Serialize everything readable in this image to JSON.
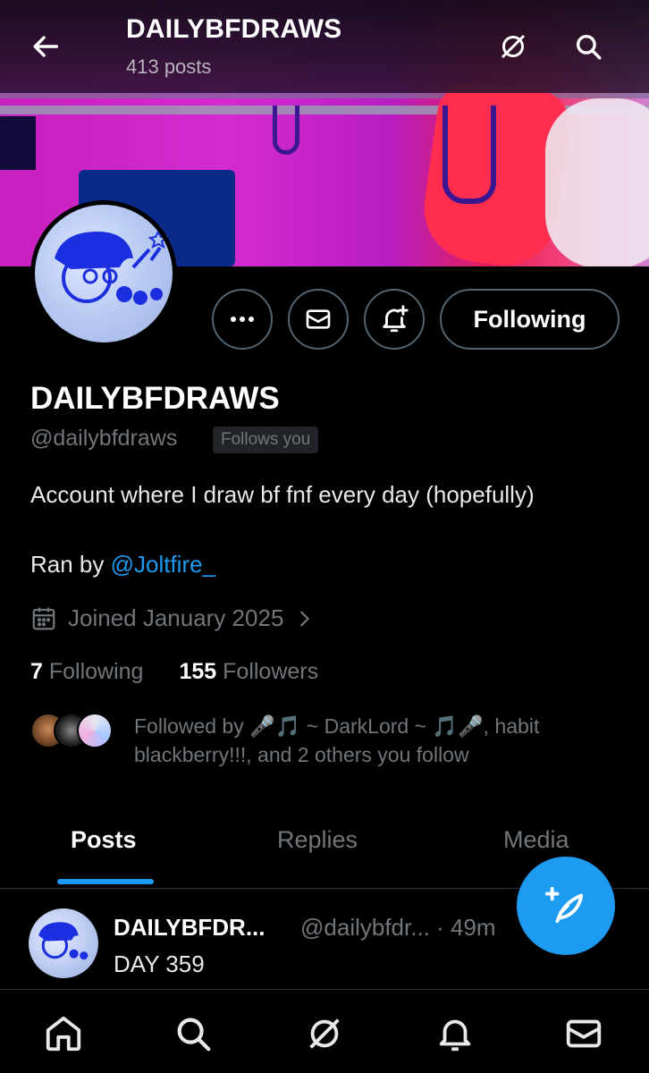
{
  "header": {
    "title": "DAILYBFDRAWS",
    "post_count": "413 posts"
  },
  "profile": {
    "display_name": "DAILYBFDRAWS",
    "handle": "@dailybfdraws",
    "follows_you_badge": "Follows you",
    "bio": "Account where I draw bf fnf every day (hopefully)",
    "ran_by_prefix": "Ran by ",
    "ran_by_mention": "@Joltfire_",
    "joined": "Joined January 2025",
    "following_count": "7",
    "following_label": "Following",
    "followers_count": "155",
    "followers_label": "Followers",
    "followed_by": "Followed by 🎤🎵 ~ DarkLord ~ 🎵🎤, habit blackberry!!!, and 2 others you follow"
  },
  "actions": {
    "following_button": "Following"
  },
  "tabs": [
    {
      "label": "Posts"
    },
    {
      "label": "Replies"
    },
    {
      "label": "Media"
    }
  ],
  "post": {
    "name": "DAILYBFDR...",
    "handle_time": "@dailybfdr... · 49m",
    "text": "DAY 359"
  },
  "colors": {
    "accent": "#1d9bf0",
    "muted": "#71767b",
    "border": "#536471"
  },
  "icons": {
    "back": "arrow-left-icon",
    "grok": "grok-icon",
    "search": "search-icon",
    "more": "more-icon",
    "message": "envelope-icon",
    "notify": "bell-plus-icon",
    "calendar": "calendar-icon",
    "compose": "compose-icon",
    "home": "home-icon",
    "notifications": "bell-icon"
  }
}
